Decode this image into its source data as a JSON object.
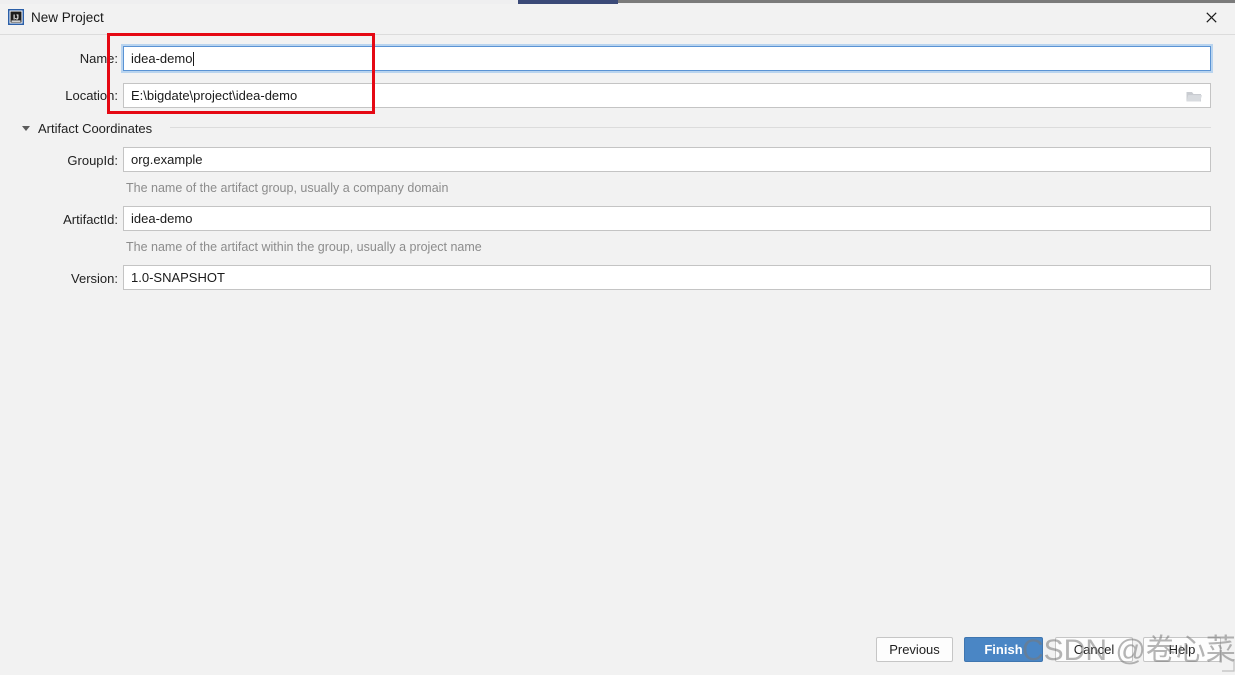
{
  "window": {
    "title": "New Project",
    "app_icon": "intellij-idea-icon",
    "close_icon": "close-icon",
    "accent_color": "#3b4a78"
  },
  "form": {
    "name": {
      "label": "Name:",
      "value": "idea-demo",
      "focused": true
    },
    "location": {
      "label": "Location:",
      "value": "E:\\bigdate\\project\\idea-demo",
      "browse_icon": "folder-icon"
    }
  },
  "section": {
    "title": "Artifact Coordinates",
    "expanded": true,
    "toggle_icon": "chevron-down-icon",
    "fields": {
      "groupid": {
        "label": "GroupId:",
        "value": "org.example",
        "hint": "The name of the artifact group, usually a company domain"
      },
      "artifactid": {
        "label": "ArtifactId:",
        "value": "idea-demo",
        "hint": "The name of the artifact within the group, usually a project name"
      },
      "version": {
        "label": "Version:",
        "value": "1.0-SNAPSHOT"
      }
    }
  },
  "footer": {
    "previous_label": "Previous",
    "finish_label": "Finish",
    "cancel_label": "Cancel",
    "help_label": "Help",
    "primary_color": "#4a86c5"
  },
  "annotation": {
    "highlight_color": "#e50914"
  },
  "watermark": {
    "text": "CSDN @卷心菜不卷Iris"
  }
}
